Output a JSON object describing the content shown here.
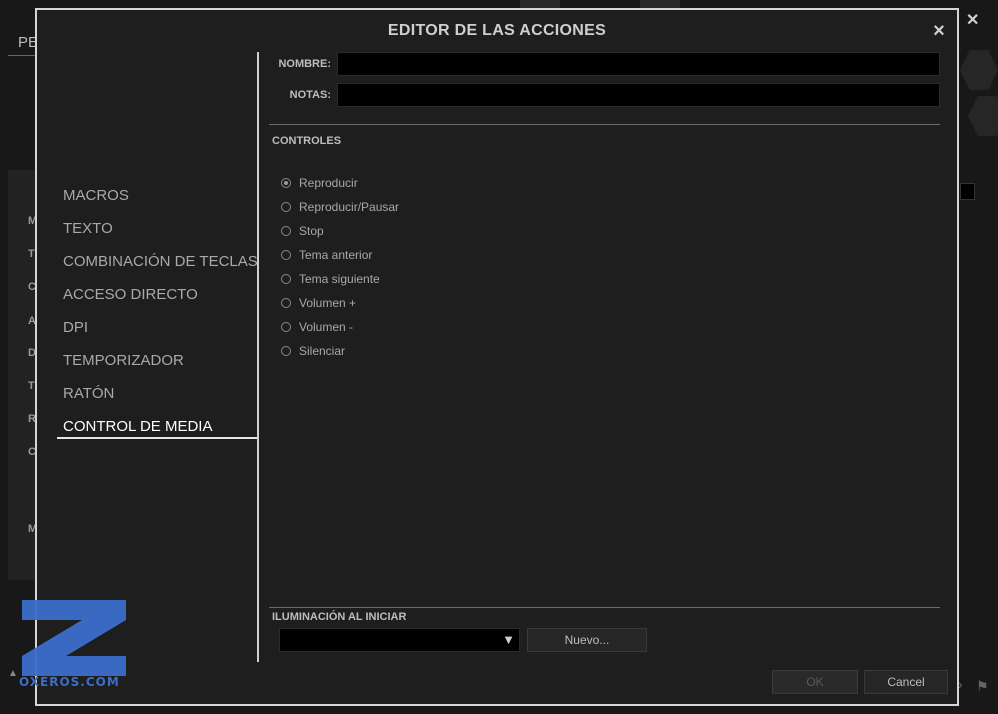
{
  "background": {
    "title_fragment": "PE",
    "left_letters": [
      "M",
      "T",
      "C",
      "A",
      "D",
      "T",
      "R",
      "C",
      "M"
    ]
  },
  "watermark": {
    "text": "OXEROS.COM"
  },
  "dialog": {
    "title": "EDITOR DE LAS ACCIONES",
    "close_icon": "×",
    "nav": [
      {
        "label": "MACROS"
      },
      {
        "label": "TEXTO"
      },
      {
        "label": "COMBINACIÓN DE TECLAS"
      },
      {
        "label": "ACCESO DIRECTO"
      },
      {
        "label": "DPI"
      },
      {
        "label": "TEMPORIZADOR"
      },
      {
        "label": "RATÓN"
      },
      {
        "label": "CONTROL DE MEDIA"
      }
    ],
    "active_nav": "CONTROL DE MEDIA",
    "fields": {
      "name_label": "NOMBRE:",
      "name_value": "",
      "notes_label": "NOTAS:",
      "notes_value": ""
    },
    "controls": {
      "label": "CONTROLES",
      "options": [
        {
          "label": "Reproducir",
          "checked": true
        },
        {
          "label": "Reproducir/Pausar",
          "checked": false
        },
        {
          "label": "Stop",
          "checked": false
        },
        {
          "label": "Tema anterior",
          "checked": false
        },
        {
          "label": "Tema siguiente",
          "checked": false
        },
        {
          "label": "Volumen +",
          "checked": false
        },
        {
          "label": "Volumen -",
          "checked": false
        },
        {
          "label": "Silenciar",
          "checked": false
        }
      ]
    },
    "lighting": {
      "label": "ILUMINACIÓN AL INICIAR",
      "selected": "",
      "new_button": "Nuevo..."
    },
    "footer": {
      "ok": "OK",
      "cancel": "Cancel"
    }
  },
  "colors": {
    "accent": "#3b6ec9",
    "dialog_bg": "#1e1e1e",
    "border": "#d6d6d6"
  }
}
